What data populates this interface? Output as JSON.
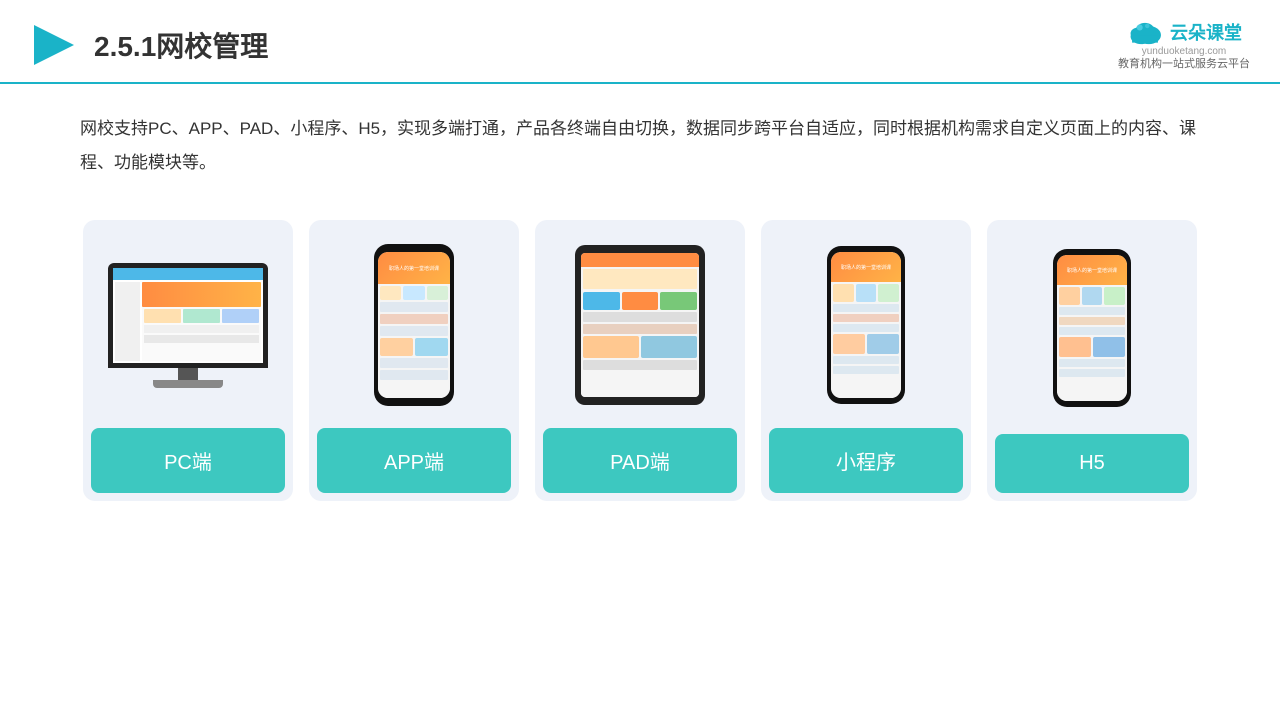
{
  "header": {
    "title": "2.5.1网校管理",
    "logo_name": "云朵课堂",
    "logo_domain": "yunduoketang.com",
    "logo_subtitle": "教育机构一站\n式服务云平台"
  },
  "description": "网校支持PC、APP、PAD、小程序、H5，实现多端打通，产品各终端自由切换，数据同步跨平台自适应，同时根据机构需求自定义页面上的内容、课程、功能模块等。",
  "cards": [
    {
      "id": "pc",
      "label": "PC端"
    },
    {
      "id": "app",
      "label": "APP端"
    },
    {
      "id": "pad",
      "label": "PAD端"
    },
    {
      "id": "miniprogram",
      "label": "小程序"
    },
    {
      "id": "h5",
      "label": "H5"
    }
  ],
  "colors": {
    "accent": "#1ab3c8",
    "card_bg": "#eef2f9",
    "card_label_bg": "#3dc8c0",
    "header_border": "#1ab3c8"
  }
}
